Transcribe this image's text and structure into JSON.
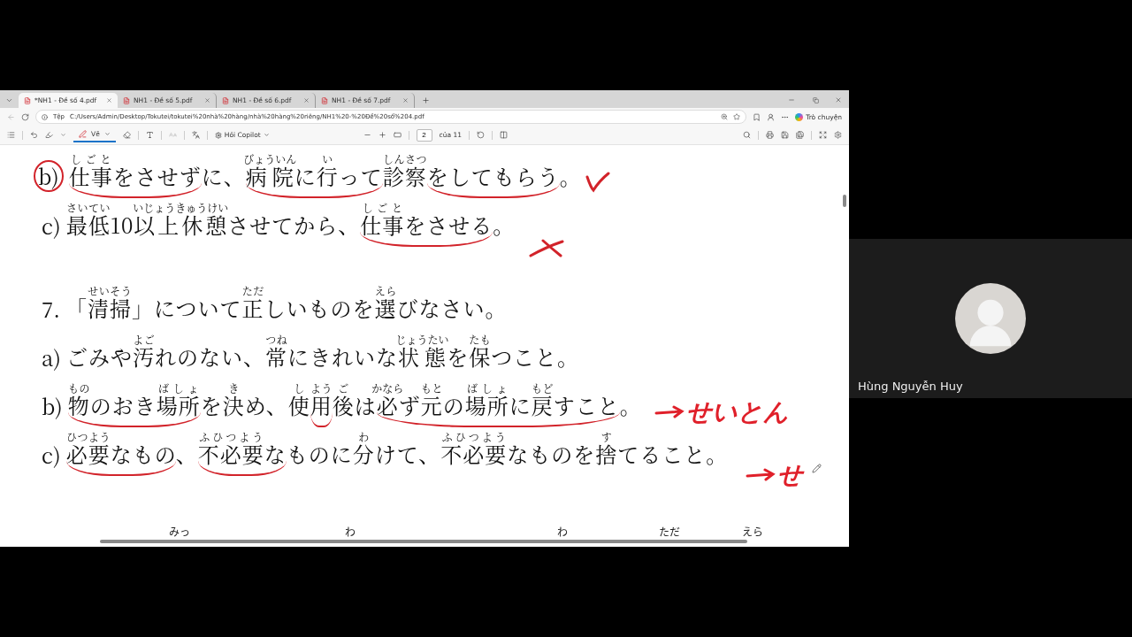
{
  "browser": {
    "tabs": [
      {
        "title": "*NH1 - Đề số 4.pdf",
        "selected": true
      },
      {
        "title": "NH1 - Đề số 5.pdf",
        "selected": false
      },
      {
        "title": "NH1 - Đề số 6.pdf",
        "selected": false
      },
      {
        "title": "NH1 - Đề số 7.pdf",
        "selected": false
      }
    ],
    "address": {
      "scheme": "Tệp",
      "url": "C:/Users/Admin/Desktop/Tokutei/tokutei%20nhà%20hàng/nhà%20hàng%20riêng/NH1%20-%20Đề%20số%204.pdf"
    },
    "chat_button": "Trò chuyện",
    "toolbar": {
      "draw_label": "Vẽ",
      "draw_selected": true,
      "copilot_label": "Hỏi Copilot",
      "page": "2",
      "page_total": "của 11"
    }
  },
  "document": {
    "lines": [
      {
        "kind": "option",
        "label": "b)",
        "circled": true,
        "chunks": [
          {
            "underlined": true,
            "parts": [
              {
                "text": "仕事",
                "ruby": "しごと"
              },
              {
                "text": "をさせず"
              }
            ]
          },
          {
            "underlined": false,
            "parts": [
              {
                "text": "に、"
              }
            ]
          },
          {
            "underlined": true,
            "parts": [
              {
                "text": "病院",
                "ruby": "びょういん"
              },
              {
                "text": "に"
              },
              {
                "text": "行",
                "ruby": "い"
              },
              {
                "text": "って"
              }
            ]
          },
          {
            "underlined": false,
            "parts": [
              {
                "text": "診察",
                "ruby": "しんさつ"
              }
            ]
          },
          {
            "underlined": true,
            "parts": [
              {
                "text": "をしてもらう"
              }
            ]
          },
          {
            "underlined": false,
            "parts": [
              {
                "text": "。"
              }
            ]
          }
        ],
        "annotation": {
          "kind": "check"
        }
      },
      {
        "kind": "option",
        "label": "c)",
        "circled": false,
        "chunks": [
          {
            "underlined": false,
            "parts": [
              {
                "text": "最低",
                "ruby": "さいてい"
              },
              {
                "text": "10"
              },
              {
                "text": "以上休憩",
                "ruby": "いじょうきゅうけい"
              },
              {
                "text": "させてから、"
              }
            ]
          },
          {
            "underlined": true,
            "parts": [
              {
                "text": "仕事",
                "ruby": "しごと"
              },
              {
                "text": "をさせる"
              }
            ]
          },
          {
            "underlined": false,
            "parts": [
              {
                "text": "。"
              }
            ]
          }
        ],
        "annotation": {
          "kind": "cross"
        }
      },
      {
        "kind": "question",
        "label": "7.",
        "circled": false,
        "chunks": [
          {
            "underlined": false,
            "parts": [
              {
                "text": "「"
              },
              {
                "text": "清掃",
                "ruby": "せいそう"
              },
              {
                "text": "」について"
              },
              {
                "text": "正",
                "ruby": "ただ"
              },
              {
                "text": "しいものを"
              },
              {
                "text": "選",
                "ruby": "えら"
              },
              {
                "text": "びなさい。"
              }
            ]
          }
        ]
      },
      {
        "kind": "option",
        "label": "a)",
        "circled": false,
        "chunks": [
          {
            "underlined": false,
            "parts": [
              {
                "text": "ごみや"
              },
              {
                "text": "汚",
                "ruby": "よご"
              },
              {
                "text": "れのない、"
              },
              {
                "text": "常",
                "ruby": "つね"
              },
              {
                "text": "にきれいな"
              },
              {
                "text": "状態",
                "ruby": "じょうたい"
              },
              {
                "text": "を"
              },
              {
                "text": "保",
                "ruby": "たも"
              },
              {
                "text": "つこと。"
              }
            ]
          }
        ]
      },
      {
        "kind": "option",
        "label": "b)",
        "circled": false,
        "chunks": [
          {
            "underlined": true,
            "parts": [
              {
                "text": "物",
                "ruby": "もの"
              },
              {
                "text": "のおき"
              },
              {
                "text": "場所",
                "ruby": "ばしょ"
              }
            ]
          },
          {
            "underlined": false,
            "parts": [
              {
                "text": "を"
              },
              {
                "text": "決",
                "ruby": "き"
              },
              {
                "text": "め、"
              },
              {
                "text": "使",
                "ruby": "し"
              }
            ]
          },
          {
            "underlined": true,
            "parts": [
              {
                "text": "用",
                "ruby": "よう"
              }
            ]
          },
          {
            "underlined": false,
            "parts": [
              {
                "text": "後",
                "ruby": "ご"
              },
              {
                "text": "は"
              }
            ]
          },
          {
            "underlined": true,
            "parts": [
              {
                "text": "必",
                "ruby": "かなら"
              },
              {
                "text": "ず"
              },
              {
                "text": "元",
                "ruby": "もと"
              },
              {
                "text": "の"
              },
              {
                "text": "場所",
                "ruby": "ばしょ"
              },
              {
                "text": "に"
              },
              {
                "text": "戻",
                "ruby": "もど"
              },
              {
                "text": "すこと"
              }
            ]
          },
          {
            "underlined": false,
            "parts": [
              {
                "text": "。"
              }
            ]
          }
        ],
        "annotation": {
          "kind": "note",
          "note": "せいとん"
        }
      },
      {
        "kind": "option",
        "label": "c)",
        "circled": false,
        "chunks": [
          {
            "underlined": true,
            "parts": [
              {
                "text": "必要",
                "ruby": "ひつよう"
              },
              {
                "text": "なもの"
              }
            ]
          },
          {
            "underlined": false,
            "parts": [
              {
                "text": "、"
              }
            ]
          },
          {
            "underlined": true,
            "parts": [
              {
                "text": "不必要",
                "ruby": "ふひつよう"
              },
              {
                "text": "な"
              }
            ]
          },
          {
            "underlined": false,
            "parts": [
              {
                "text": "ものに"
              },
              {
                "text": "分",
                "ruby": "わ"
              },
              {
                "text": "けて、"
              },
              {
                "text": "不必要",
                "ruby": "ふひつよう"
              },
              {
                "text": "なものを"
              },
              {
                "text": "捨",
                "ruby": "す"
              },
              {
                "text": "てること。"
              }
            ]
          }
        ],
        "annotation": {
          "kind": "note",
          "note": "せ"
        }
      }
    ],
    "cut_ruby": [
      "みっ",
      "わ",
      "わ",
      "ただ",
      "えら"
    ]
  },
  "participant": {
    "name": "Hùng Nguyễn Huy"
  }
}
